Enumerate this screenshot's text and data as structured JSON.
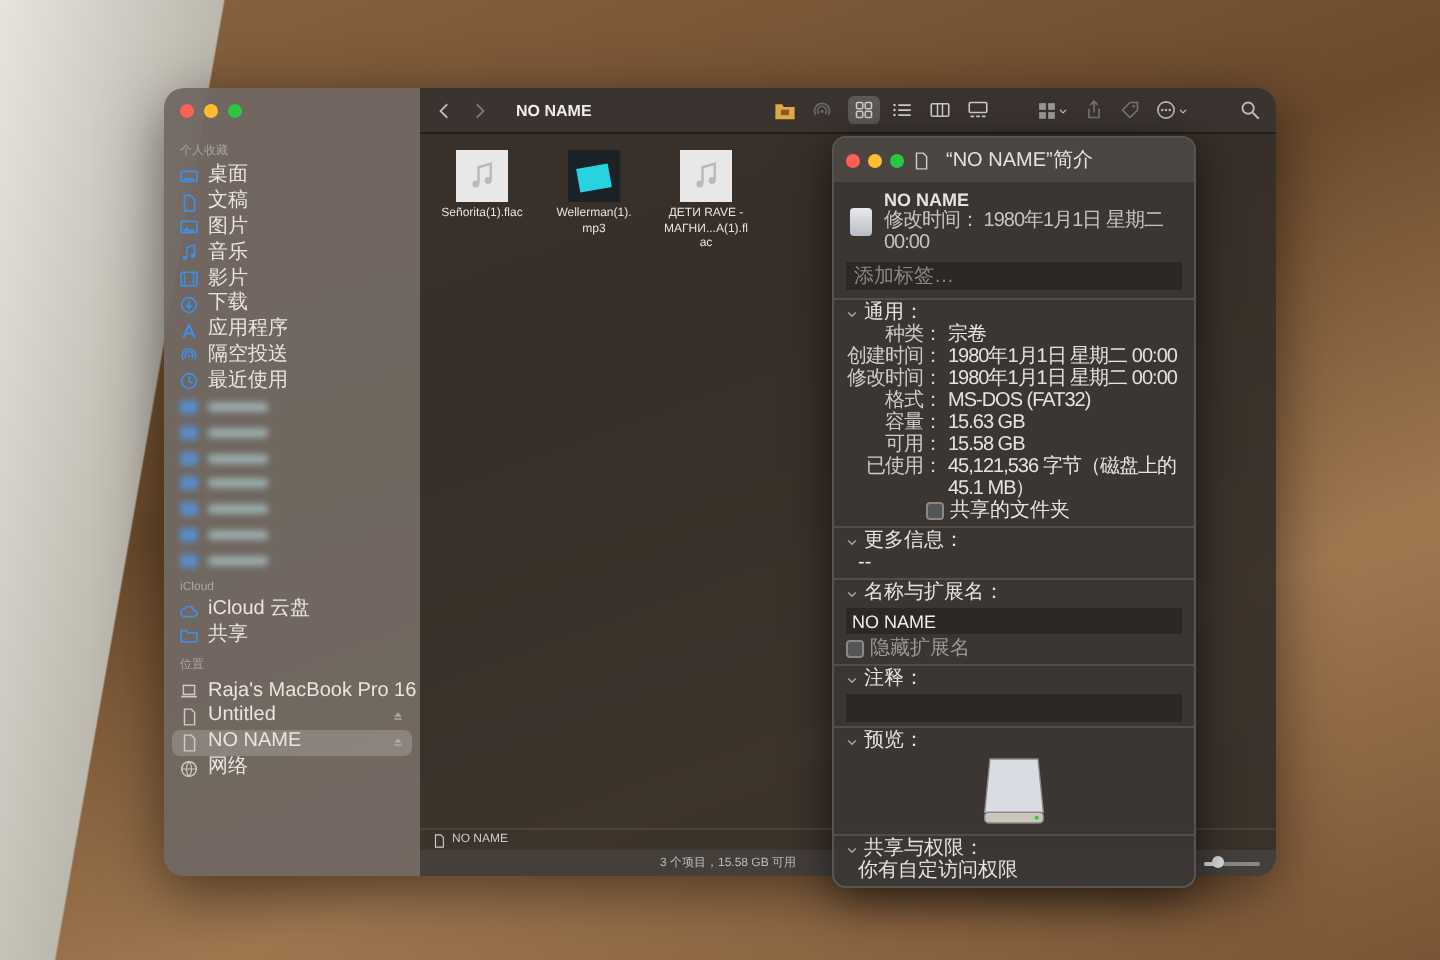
{
  "finder": {
    "traffic_lights": [
      {
        "color": "#fe5f57"
      },
      {
        "color": "#febc2e"
      },
      {
        "color": "#28c840"
      }
    ],
    "sidebar": {
      "sections": [
        {
          "heading": "个人收藏",
          "items": [
            {
              "label": "桌面",
              "selected": false,
              "ejectable": false
            },
            {
              "label": "文稿",
              "selected": false,
              "ejectable": false
            },
            {
              "label": "图片",
              "selected": false,
              "ejectable": false
            },
            {
              "label": "音乐",
              "selected": false,
              "ejectable": false
            },
            {
              "label": "影片",
              "selected": false,
              "ejectable": false
            },
            {
              "label": "下载",
              "selected": false,
              "ejectable": false
            },
            {
              "label": "应用程序",
              "selected": false,
              "ejectable": false
            },
            {
              "label": "隔空投送",
              "selected": false,
              "ejectable": false
            },
            {
              "label": "最近使用",
              "selected": false,
              "ejectable": false
            }
          ]
        },
        {
          "heading": "iCloud",
          "items": [
            {
              "label": "iCloud 云盘",
              "selected": false,
              "ejectable": false
            },
            {
              "label": "共享",
              "selected": false,
              "ejectable": false
            }
          ]
        },
        {
          "heading": "位置",
          "items": [
            {
              "label": "Raja's MacBook Pro 16",
              "selected": false,
              "ejectable": false
            },
            {
              "label": "Untitled",
              "selected": false,
              "ejectable": true
            },
            {
              "label": "NO NAME",
              "selected": true,
              "ejectable": true
            },
            {
              "label": "网络",
              "selected": false,
              "ejectable": false
            }
          ]
        }
      ]
    },
    "toolbar": {
      "title": "NO NAME",
      "view_modes": [
        {
          "selected": true
        },
        {
          "selected": false
        },
        {
          "selected": false
        },
        {
          "selected": false
        }
      ]
    },
    "files": [
      {
        "name": "Señorita(1).flac",
        "kind": "audio"
      },
      {
        "name": "Wellerman(1).mp3",
        "kind": "artwork"
      },
      {
        "name": "ДЕТИ RAVE - МАГНИ...А(1).flac",
        "kind": "audio"
      }
    ],
    "path_bar": {
      "label": "NO NAME"
    },
    "status_bar": {
      "text": "3 个项目，15.58 GB 可用",
      "icon_size": {
        "level": 0.25
      }
    }
  },
  "info_window": {
    "title": "“NO NAME”简介",
    "name": "NO NAME",
    "modified": "修改时间：  1980年1月1日 星期二 00:00",
    "tags": {
      "placeholder": "添加标签…"
    },
    "sections": [
      {
        "kind": "general",
        "heading": "通用：",
        "expanded": true,
        "rows": [
          {
            "label": "种类：",
            "value": "宗卷"
          },
          {
            "label": "创建时间：",
            "value": "1980年1月1日 星期二 00:00"
          },
          {
            "label": "修改时间：",
            "value": "1980年1月1日 星期二 00:00"
          },
          {
            "label": "格式：",
            "value": "MS-DOS (FAT32)"
          },
          {
            "label": "容量：",
            "value": "15.63 GB"
          },
          {
            "label": "可用：",
            "value": "15.58 GB"
          },
          {
            "label": "已使用：",
            "value": "45,121,536 字节（磁盘上的 45.1 MB）"
          }
        ],
        "checkbox": {
          "label": "共享的文件夹",
          "checked": false
        }
      },
      {
        "kind": "text",
        "heading": "更多信息：",
        "expanded": true,
        "text": "--"
      },
      {
        "kind": "name",
        "heading": "名称与扩展名：",
        "expanded": true,
        "value": "NO NAME",
        "checkbox": {
          "label": "隐藏扩展名",
          "checked": false
        }
      },
      {
        "kind": "comments",
        "heading": "注释：",
        "expanded": true
      },
      {
        "kind": "preview",
        "heading": "预览：",
        "expanded": true
      },
      {
        "kind": "text",
        "heading": "共享与权限：",
        "expanded": true,
        "text": "你有自定访问权限"
      }
    ]
  }
}
